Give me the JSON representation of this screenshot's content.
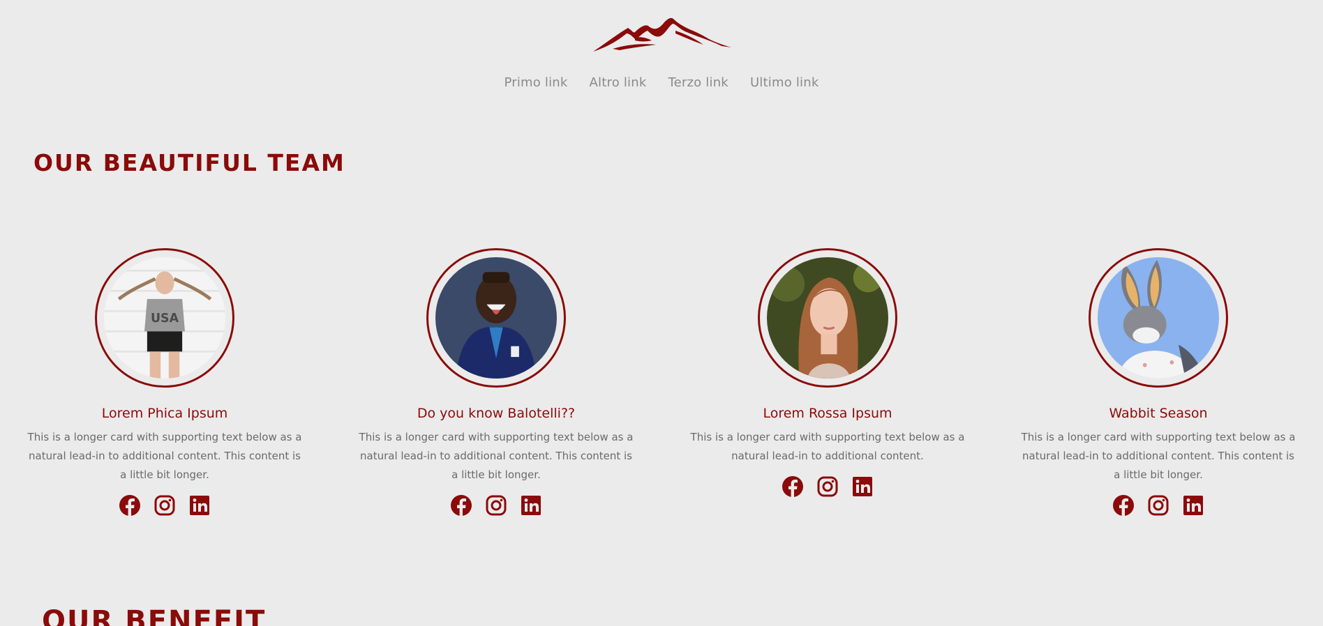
{
  "nav": {
    "links": [
      "Primo link",
      "Altro link",
      "Terzo link",
      "Ultimo link"
    ]
  },
  "team": {
    "title": "OUR BEAUTIFUL TEAM",
    "members": [
      {
        "name": "Lorem Phica Ipsum",
        "text": "This is a longer card with supporting text below as a natural lead-in to additional content. This content is a little bit longer.",
        "photo": "woman-usa-shirt-photo"
      },
      {
        "name": "Do you know Balotelli??",
        "text": "This is a longer card with supporting text below as a natural lead-in to additional content. This content is a little bit longer.",
        "photo": "footballer-photo"
      },
      {
        "name": "Lorem Rossa Ipsum",
        "text": "This is a longer card with supporting text below as a natural lead-in to additional content.",
        "photo": "red-haired-woman-photo"
      },
      {
        "name": "Wabbit Season",
        "text": "This is a longer card with supporting text below as a natural lead-in to additional content. This content is a little bit longer.",
        "photo": "cartoon-rabbit-photo"
      }
    ],
    "social_icons": [
      "facebook-icon",
      "instagram-icon",
      "linkedin-icon"
    ]
  },
  "benefit": {
    "title": "OUR BENEFIT"
  },
  "colors": {
    "accent": "#8b0a0a",
    "background": "#ebebeb",
    "nav_text": "#8a8a8a",
    "body_text": "#6a6a6a"
  }
}
